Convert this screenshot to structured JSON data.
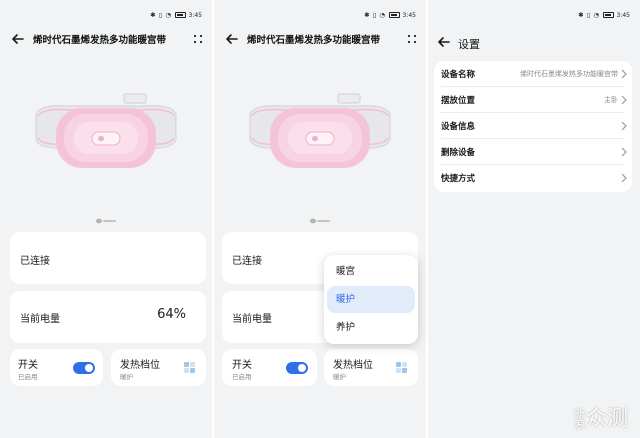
{
  "status_bar": {
    "time": "3:45"
  },
  "device_page": {
    "title": "烯时代石墨烯发热多功能暖宫带",
    "connection_status": "已连接",
    "battery_label": "当前电量",
    "battery_value": "64%",
    "switch_label": "开关",
    "switch_status": "已启用",
    "heat_label": "发热档位",
    "heat_value": "暖护"
  },
  "heat_menu": {
    "options": [
      "暖宫",
      "暖护",
      "养护"
    ],
    "selected": "暖护"
  },
  "settings_page": {
    "title": "设置",
    "rows": [
      {
        "label": "设备名称",
        "value": "烯时代石墨烯发热多功能暖宫带"
      },
      {
        "label": "摆放位置",
        "value": "主卧"
      },
      {
        "label": "设备信息",
        "value": ""
      },
      {
        "label": "删除设备",
        "value": ""
      },
      {
        "label": "快捷方式",
        "value": ""
      }
    ]
  },
  "colors": {
    "accent": "#2f6fe8",
    "background": "#f1f3f5",
    "card": "#ffffff",
    "device_pink": "#f6c6dc"
  },
  "icons": [
    "back-arrow-icon",
    "more-icon",
    "grid-icon",
    "chevron-right-icon"
  ],
  "watermark": {
    "line1": "新",
    "line2": "浪",
    "text": "众测"
  }
}
